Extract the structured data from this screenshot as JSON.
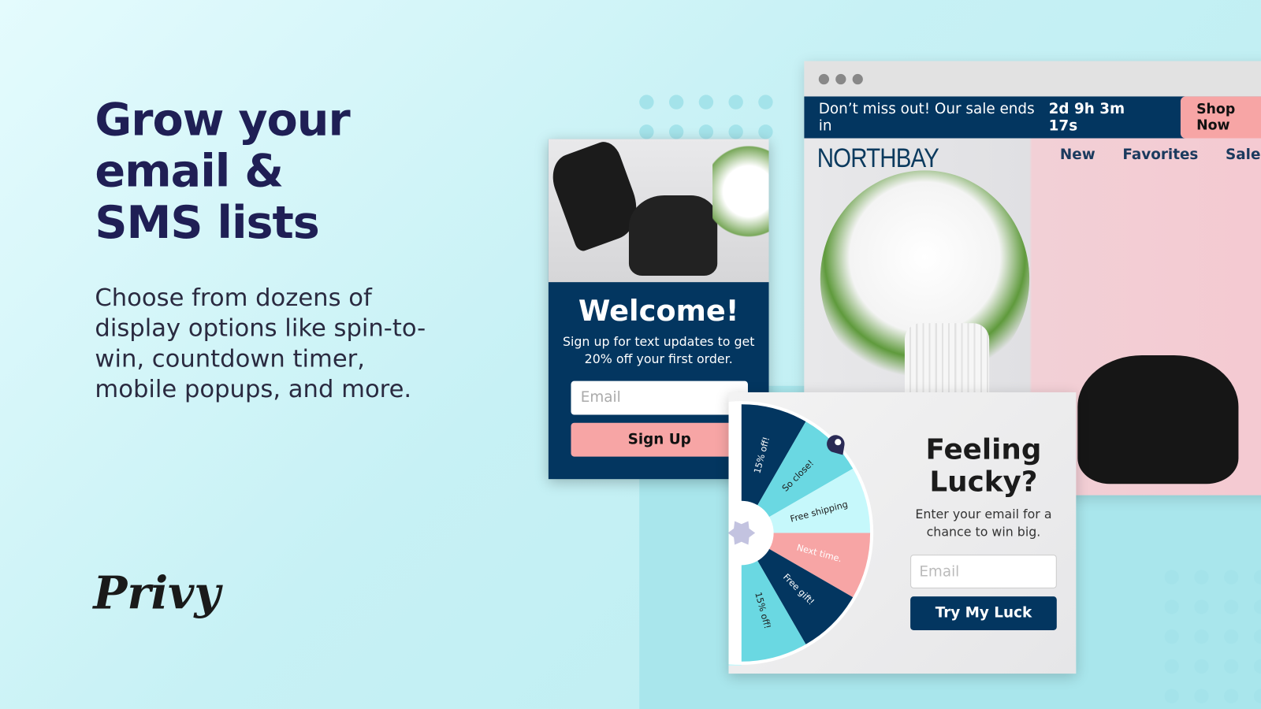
{
  "hero": {
    "title_lines": [
      "Grow your",
      "email &",
      "SMS lists"
    ],
    "description": "Choose from dozens of display options like spin-to-win, countdown timer, mobile popups, and more.",
    "logo": "Privy"
  },
  "browser": {
    "banner_text": "Don’t miss out! Our sale ends in",
    "countdown": "2d 9h 3m 17s",
    "shop_button": "Shop Now",
    "brand": "NORTHBAY",
    "nav": [
      "New",
      "Favorites",
      "Sale"
    ]
  },
  "welcome_popup": {
    "title": "Welcome!",
    "text": "Sign up for text updates to get 20% off your first order.",
    "email_placeholder": "Email",
    "button": "Sign Up"
  },
  "spin_popup": {
    "title": "Feeling Lucky?",
    "text": "Enter your email for a chance to win big.",
    "email_placeholder": "Email",
    "button": "Try My Luck",
    "wheel": [
      {
        "label": "15% off!",
        "color": "#033660",
        "text": "#ffffff"
      },
      {
        "label": "So close!",
        "color": "#6ad8e2",
        "text": "#1b1b1b"
      },
      {
        "label": "Free shipping",
        "color": "#c6f8fb",
        "text": "#1b1b1b"
      },
      {
        "label": "Next time.",
        "color": "#f7a5a5",
        "text": "#ffffff"
      },
      {
        "label": "Free gift!",
        "color": "#033660",
        "text": "#ffffff"
      },
      {
        "label": "15% off!",
        "color": "#6ad8e2",
        "text": "#1b1b1b"
      }
    ]
  },
  "colors": {
    "navy": "#033660",
    "pink": "#f7a5a5",
    "teal": "#6ad8e2",
    "headline": "#1f1f55"
  }
}
